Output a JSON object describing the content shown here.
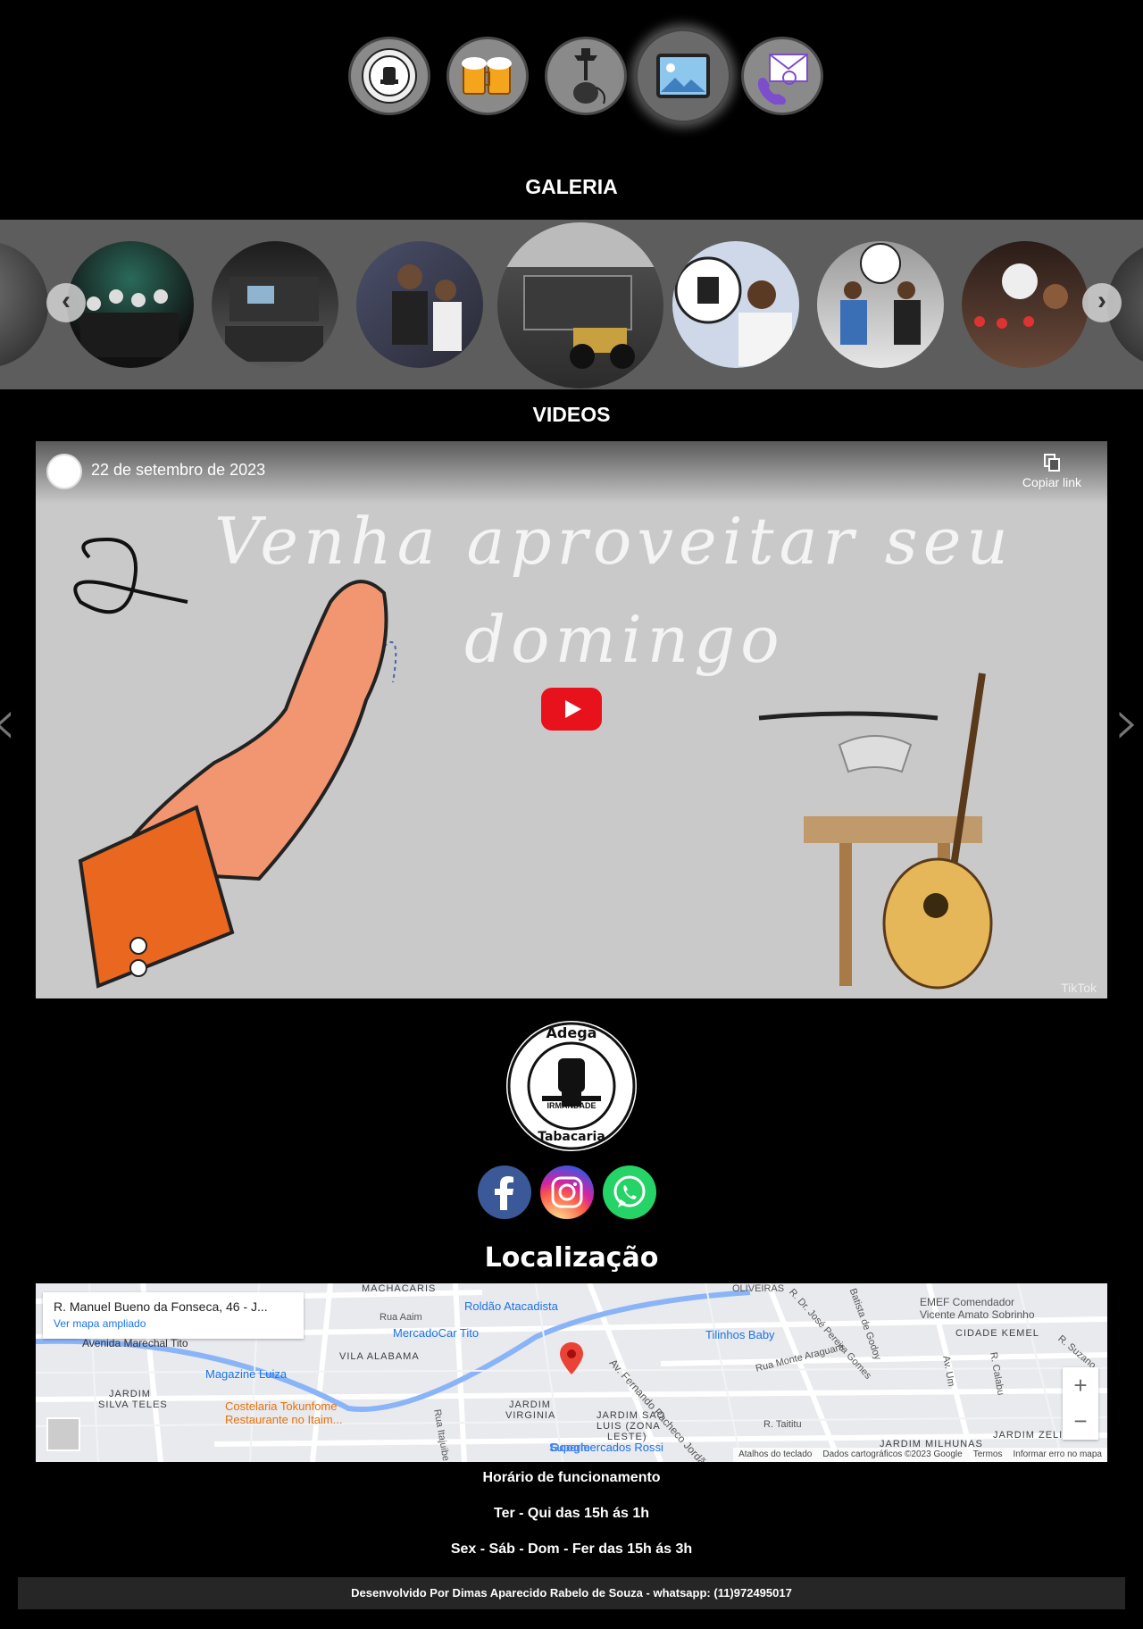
{
  "nav": {
    "items": [
      {
        "icon": "adega-logo-icon"
      },
      {
        "icon": "beer-mugs-icon"
      },
      {
        "icon": "hookah-icon"
      },
      {
        "icon": "image-gallery-icon"
      },
      {
        "icon": "contact-envelope-icon"
      }
    ]
  },
  "gallery": {
    "title": "GALERIA",
    "prev_label": "‹",
    "next_label": "›"
  },
  "videos": {
    "title": "VIDEOS",
    "date": "22 de setembro de 2023",
    "copy_link": "Copiar link",
    "caption_line1": "Venha aproveitar seu",
    "caption_line2": "domingo",
    "watermark": "TikTok"
  },
  "logo": {
    "top_text": "Adega",
    "middle_text": "IRMANDADE",
    "bottom_text": "Tabacaria"
  },
  "social": [
    "facebook-icon",
    "instagram-icon",
    "whatsapp-icon"
  ],
  "location": {
    "title": "Localização",
    "address": "R. Manuel Bueno da Fonseca, 46 - J...",
    "map_link": "Ver mapa ampliado",
    "labels": {
      "machacaris": "MACHACARIS",
      "roldao": "Roldão Atacadista",
      "mercado": "MercadoCar Tito",
      "tilinhos": "Tilinhos Baby",
      "emef1": "EMEF Comendador",
      "emef2": "Vicente Amato Sobrinho",
      "cidade_kemel": "CIDADE KEMEL",
      "marechal": "Avenida Marechal Tito",
      "magazine": "Magazine Luiza",
      "vila_alabama": "VILA ALABAMA",
      "silva_teles1": "JARDIM",
      "silva_teles2": "SILVA TELES",
      "costelaria1": "Costelaria Tokunfome",
      "costelaria2": "Restaurante no Itaim...",
      "itajuibe": "Rua Itajuibe",
      "virginia1": "JARDIM",
      "virginia2": "VIRGINIA",
      "sao_luis1": "JARDIM SAO",
      "sao_luis2": "LUIS (ZONA",
      "sao_luis3": "LESTE)",
      "rossi": "Supermercados Rossi",
      "fernando": "Av. Fernando Pacheco Jordão",
      "monte": "Rua Monte Araguara",
      "taititu": "R. Taititu",
      "zelia": "JARDIM ZELIA",
      "milhunas": "JARDIM MILHUNAS",
      "jose": "R. Dr. José Pereira Gomes",
      "batista": "Batista de Godoy",
      "oliveiras": "OLIVEIRAS",
      "um": "Av. Um",
      "calabu": "R. Calabu",
      "suzano": "R. Suzano",
      "rua_aaim": "Rua Aaim"
    },
    "zoom_in": "+",
    "zoom_out": "−",
    "footer": [
      "Atalhos do teclado",
      "Dados cartográficos ©2023 Google",
      "Termos",
      "Informar erro no mapa"
    ],
    "google": "Google"
  },
  "hours": {
    "title": "Horário de funcionamento",
    "line1": "Ter - Qui das 15h ás 1h",
    "line2": "Sex - Sáb - Dom - Fer das 15h ás 3h"
  },
  "footer": {
    "credit": "Desenvolvido Por Dimas Aparecido Rabelo de Souza - whatsapp: (11)972495017"
  },
  "colors": {
    "gallery_bg": "#5d5d5d",
    "play_red": "#e8121d",
    "facebook": "#3b5998",
    "whatsapp": "#25d366"
  }
}
